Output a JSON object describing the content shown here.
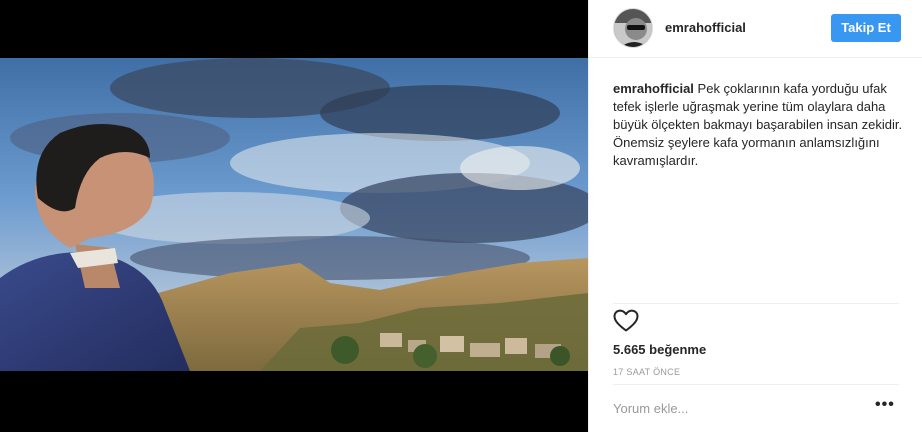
{
  "post": {
    "username": "emrahofficial",
    "follow_label": "Takip Et",
    "caption_user": "emrahofficial",
    "caption_text": "Pek çoklarının kafa yorduğu ufak tefek işlerle uğraşmak yerine tüm olaylara daha büyük ölçekten bakmayı başarabilen insan zekidir. Önemsiz şeylere kafa yormanın anlamsızlığını kavramışlardır.",
    "likes": "5.665 beğenme",
    "time_ago": "17 SAAT ÖNCE",
    "comment_placeholder": "Yorum ekle...",
    "more_symbol": "•••"
  },
  "icons": {
    "like": "heart-outline-icon",
    "more": "ellipsis-icon"
  },
  "colors": {
    "follow_button": "#3897f0",
    "divider": "#efefef",
    "muted_text": "#999999",
    "media_background": "#000000"
  }
}
